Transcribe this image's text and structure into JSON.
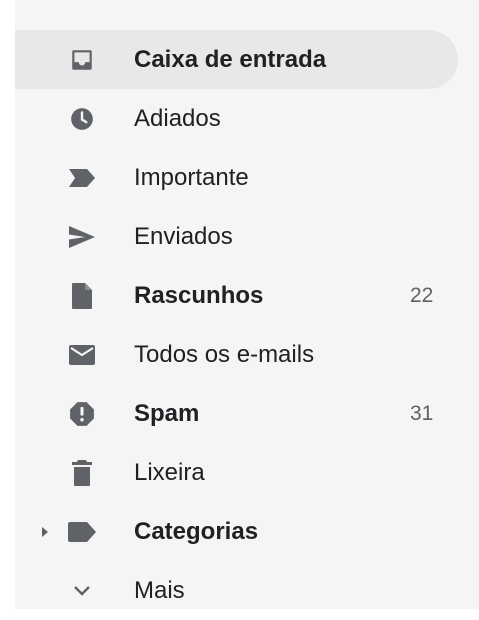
{
  "nav": {
    "items": [
      {
        "label": "Caixa de entrada",
        "count": "",
        "icon": "inbox-icon",
        "active": true,
        "bold": true
      },
      {
        "label": "Adiados",
        "count": "",
        "icon": "clock-icon",
        "active": false,
        "bold": false
      },
      {
        "label": "Importante",
        "count": "",
        "icon": "important-marker-icon",
        "active": false,
        "bold": false
      },
      {
        "label": "Enviados",
        "count": "",
        "icon": "send-icon",
        "active": false,
        "bold": false
      },
      {
        "label": "Rascunhos",
        "count": "22",
        "icon": "draft-file-icon",
        "active": false,
        "bold": true
      },
      {
        "label": "Todos os e-mails",
        "count": "",
        "icon": "mail-envelope-icon",
        "active": false,
        "bold": false
      },
      {
        "label": "Spam",
        "count": "31",
        "icon": "spam-alert-icon",
        "active": false,
        "bold": true
      },
      {
        "label": "Lixeira",
        "count": "",
        "icon": "trash-icon",
        "active": false,
        "bold": false
      },
      {
        "label": "Categorias",
        "count": "",
        "icon": "label-icon",
        "active": false,
        "bold": true,
        "expander": "caret-right-icon"
      },
      {
        "label": "Mais",
        "count": "",
        "icon": "chevron-down-icon",
        "active": false,
        "bold": false
      }
    ]
  },
  "colors": {
    "panel_background": "#f5f5f5",
    "active_background": "#e8e8e8",
    "icon": "#5f6368",
    "text": "#202124"
  }
}
